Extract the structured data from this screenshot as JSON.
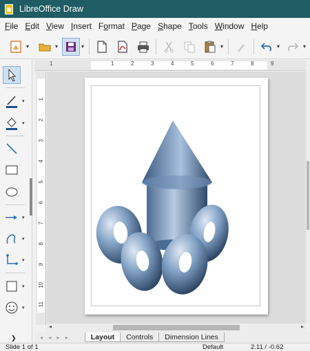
{
  "window": {
    "title": "LibreOffice Draw"
  },
  "menubar": {
    "items": [
      {
        "accel": "F",
        "rest": "ile"
      },
      {
        "accel": "E",
        "rest": "dit"
      },
      {
        "accel": "V",
        "rest": "iew"
      },
      {
        "accel": "I",
        "rest": "nsert"
      },
      {
        "accel": "F",
        "rest": "ormat",
        "accel_pos": "after",
        "pre": "F",
        "post": "rmat",
        "mid": "o"
      },
      {
        "accel": "P",
        "rest": "age"
      },
      {
        "accel": "S",
        "rest": "hape"
      },
      {
        "accel": "T",
        "rest": "ools"
      },
      {
        "accel": "W",
        "rest": "indow"
      },
      {
        "accel": "H",
        "rest": "elp"
      }
    ]
  },
  "toolbar": {
    "buttons": [
      "new-document-icon",
      "open-folder-icon",
      "save-icon",
      "export-icon",
      "export-pdf-icon",
      "print-icon",
      "cut-icon",
      "copy-icon",
      "paste-icon",
      "clone-formatting-icon",
      "undo-icon",
      "redo-icon"
    ]
  },
  "sidebar": {
    "tools": [
      "select-arrow-icon",
      "line-color-icon",
      "fill-color-icon",
      "line-tool-icon",
      "rectangle-icon",
      "ellipse-icon",
      "arrow-line-icon",
      "curve-icon",
      "connector-icon",
      "basic-shape-icon",
      "smiley-icon"
    ]
  },
  "hruler": {
    "labels": [
      "1",
      "1",
      "2",
      "3",
      "4",
      "5",
      "6",
      "7",
      "8",
      "9"
    ]
  },
  "vruler": {
    "labels": [
      "1",
      "2",
      "3",
      "4",
      "5",
      "6",
      "7",
      "8",
      "9",
      "10",
      "11"
    ]
  },
  "tabs": {
    "items": [
      "Layout",
      "Controls",
      "Dimension Lines"
    ],
    "active": "Layout",
    "nav": "◂ ◂ ▸ ▸"
  },
  "statusbar": {
    "slide": "Slide 1 of 1",
    "layout": "Default",
    "position": "2.11 / -0.62"
  },
  "colors": {
    "titlebar": "#1f5c64",
    "shape_light": "#c9d8ea",
    "shape_mid": "#7f9fc3",
    "shape_dark": "#2c4868"
  }
}
